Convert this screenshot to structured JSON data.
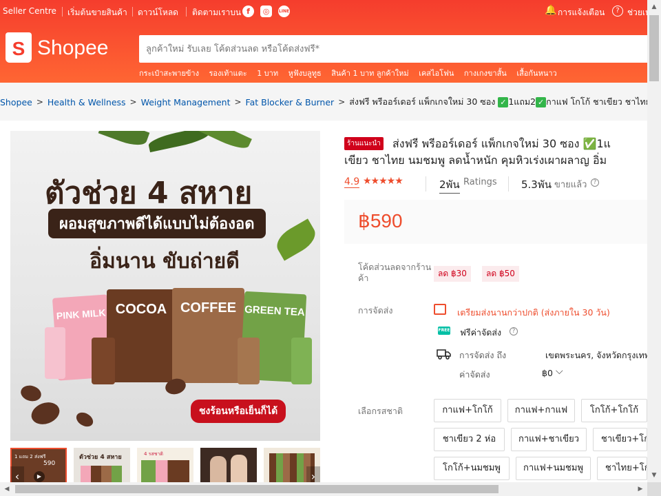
{
  "topbar": {
    "seller_centre": "Seller Centre",
    "start_selling": "เริ่มต้นขายสินค้า",
    "download": "ดาวน์โหลด",
    "follow_us": "ติดตามเราบน",
    "notifications": "การแจ้งเตือน",
    "help": "ช่วยเหลือ"
  },
  "brand": {
    "logo_text": "Shopee",
    "logo_letter": "S"
  },
  "search": {
    "placeholder": "ลูกค้าใหม่ รับเลย โค้ดส่วนลด หรือโค้ดส่งฟรี*"
  },
  "quick_links": [
    "กระเป๋าสะพายข้าง",
    "รองเท้าแตะ",
    "1 บาท",
    "หูฟังบลูทูธ",
    "สินค้า 1 บาท ลูกค้าใหม่",
    "เคสไอโฟน",
    "กางเกงขาสั้น",
    "เสื้อกันหนาว"
  ],
  "breadcrumb": {
    "items": [
      "Shopee",
      "Health & Wellness",
      "Weight Management",
      "Fat Blocker & Burner"
    ],
    "current_a": "ส่งฟรี พรีออร์เดอร์ แพ็กเกจใหม่ 30 ซอง",
    "current_b": "1แถม2",
    "current_c": "กาแฟ โกโก้ ชาเขียว ชาไทย"
  },
  "product_image": {
    "headline": "ตัวช่วย 4 สหาย",
    "subheadline": "ผอมสุขภาพดีได้แบบไม่ต้องอด",
    "tagline": "อิ่มนาน ขับถ่ายดี",
    "packs": [
      "PINK MILK",
      "COCOA",
      "COFFEE",
      "GREEN TEA"
    ],
    "ribbon": "ชงร้อนหรือเย็นก็ได้"
  },
  "thumbnails": [
    {
      "line1": "1 แถม 2 ส่งฟรี",
      "line2": "590"
    },
    {
      "line1": "ตัวช่วย 4 สหาย",
      "line2": ""
    },
    {
      "line1": "4 รสชาติ",
      "line2": ""
    },
    {
      "line1": "",
      "line2": ""
    },
    {
      "line1": "",
      "line2": ""
    }
  ],
  "product": {
    "mall_badge": "ร้านแนะนำ",
    "title_line1": "ส่งฟรี พรีออร์เดอร์ แพ็กเกจใหม่ 30 ซอง ✅1แ",
    "title_line2": "เขียว ชาไทย นมชมพู ลดน้ำหนัก คุมหิวเร่งเผาผลาญ อิ่ม",
    "rating": "4.9",
    "stars": "★★★★★",
    "ratings_count": "2พัน",
    "ratings_label": "Ratings",
    "sold_count": "5.3พัน",
    "sold_label": "ขายแล้ว",
    "price": "฿590"
  },
  "vouchers": {
    "label": "โค้ดส่วนลดจากร้านค้า",
    "items": [
      "ลด ฿30",
      "ลด ฿50"
    ]
  },
  "shipping": {
    "label": "การจัดส่ง",
    "preorder": "เตรียมส่งนานกว่าปกติ (ส่งภายใน 30 วัน)",
    "free_icon": "FREE",
    "free": "ฟรีค่าจัดส่ง",
    "to_label": "การจัดส่ง ถึง",
    "to_value": "เขตพระนคร, จังหวัดกรุงเทพ",
    "fee_label": "ค่าจัดส่ง",
    "fee_value": "฿0"
  },
  "flavours": {
    "label": "เลือกรสชาติ",
    "options": [
      "กาแฟ+โกโก้",
      "กาแฟ+กาแฟ",
      "โกโก้+โกโก้",
      "ชาเขียว 2 ห่อ",
      "กาแฟ+ชาเขียว",
      "ชาเขียว+โก",
      "โกโก้+นมชมพู",
      "กาแฟ+นมชมพู",
      "ชาไทย+โก"
    ]
  },
  "colors": {
    "brand": "#ee4d2d",
    "header_top": "#f53d2d",
    "header_bottom": "#ff6633",
    "mall": "#d0011b",
    "link": "#0055aa"
  }
}
